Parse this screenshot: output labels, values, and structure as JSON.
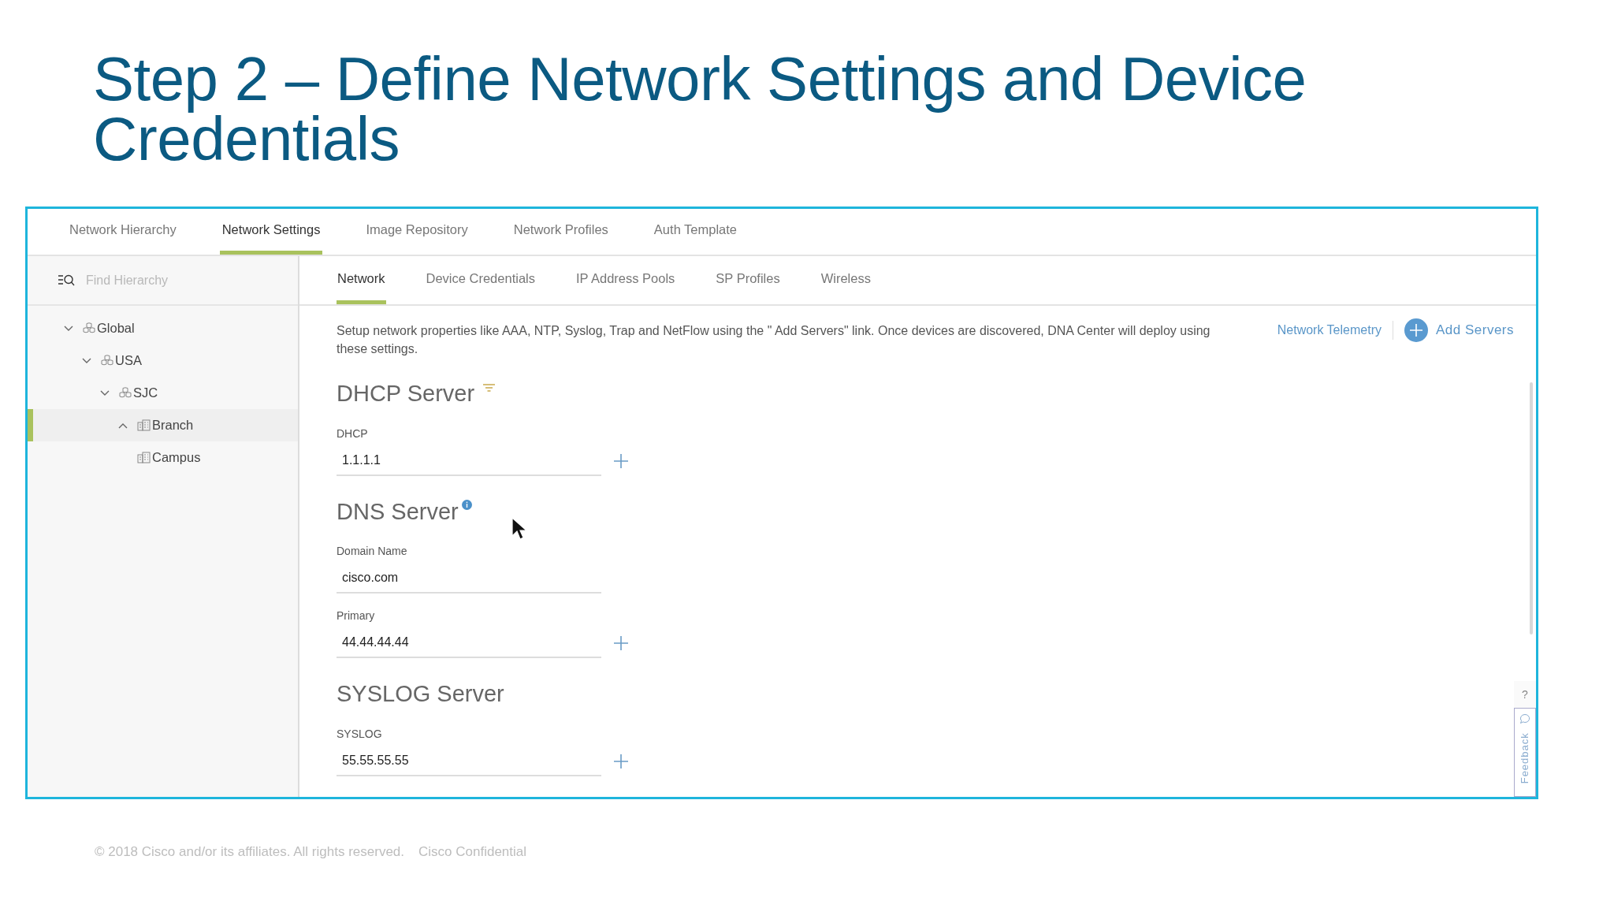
{
  "slide_title": "Step 2 – Define Network Settings and Device Credentials",
  "tabs": [
    {
      "label": "Network Hierarchy",
      "selected": false
    },
    {
      "label": "Network Settings",
      "selected": true
    },
    {
      "label": "Image Repository",
      "selected": false
    },
    {
      "label": "Network Profiles",
      "selected": false
    },
    {
      "label": "Auth Template",
      "selected": false
    }
  ],
  "sidebar": {
    "search": {
      "placeholder": "Find Hierarchy"
    },
    "tree": [
      {
        "label": "Global",
        "kind": "area",
        "expanded": true,
        "selected": false,
        "children": [
          {
            "label": "USA",
            "kind": "area",
            "expanded": true,
            "selected": false,
            "children": [
              {
                "label": "SJC",
                "kind": "area",
                "expanded": true,
                "selected": false,
                "children": [
                  {
                    "label": "Branch",
                    "kind": "building",
                    "expanded": false,
                    "selected": true
                  },
                  {
                    "label": "Campus",
                    "kind": "building",
                    "selected": false
                  }
                ]
              }
            ]
          }
        ]
      }
    ]
  },
  "subtabs": [
    {
      "label": "Network",
      "selected": true
    },
    {
      "label": "Device Credentials",
      "selected": false
    },
    {
      "label": "IP Address Pools",
      "selected": false
    },
    {
      "label": "SP Profiles",
      "selected": false
    },
    {
      "label": "Wireless",
      "selected": false
    }
  ],
  "description": "Setup network properties like AAA, NTP, Syslog, Trap and NetFlow using the \" Add Servers\"  link. Once devices are discovered, DNA Center will deploy using these settings.",
  "links": {
    "telemetry": "Network Telemetry",
    "add_servers": "Add Servers"
  },
  "sections": [
    {
      "title": "DHCP Server",
      "kind": "filter",
      "fields": [
        {
          "label": "DHCP",
          "value": "1.1.1.1",
          "addable": true
        }
      ]
    },
    {
      "title": "DNS Server",
      "kind": "info",
      "fields": [
        {
          "label": "Domain Name",
          "value": "cisco.com",
          "addable": false
        },
        {
          "label": "Primary",
          "value": "44.44.44.44",
          "addable": true
        }
      ]
    },
    {
      "title": "SYSLOG Server",
      "kind": "plain",
      "fields": [
        {
          "label": "SYSLOG",
          "value": "55.55.55.55",
          "addable": true
        }
      ]
    }
  ],
  "help": "?",
  "feedback": "Feedback",
  "footer": {
    "copyright": "© 2018  Cisco and/or its affiliates. All rights reserved.",
    "confidential": "Cisco Confidential"
  }
}
